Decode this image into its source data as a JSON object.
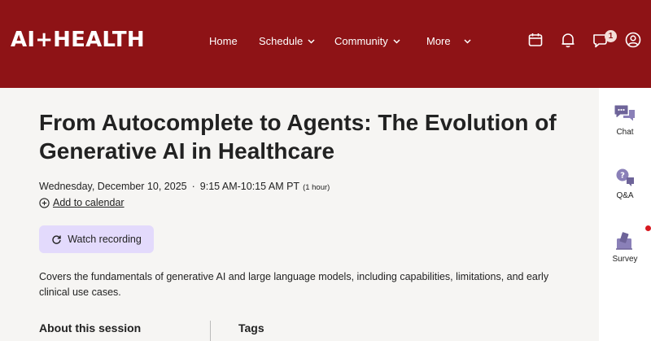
{
  "header": {
    "brand": "AI+HEALTH",
    "nav": [
      {
        "label": "Home",
        "dropdown": false
      },
      {
        "label": "Schedule",
        "dropdown": true
      },
      {
        "label": "Community",
        "dropdown": true
      },
      {
        "label": "More",
        "dropdown": true
      }
    ],
    "icons": [
      "calendar-icon",
      "bell-icon",
      "chat-icon",
      "profile-icon"
    ],
    "chat_badge": "1",
    "brand_color": "#8e1316"
  },
  "session": {
    "title": "From Autocomplete to Agents: The Evolution of Generative AI in Healthcare",
    "date": "Wednesday, December 10, 2025",
    "separator": "·",
    "time": "9:15 AM-10:15 AM PT",
    "duration": "(1 hour)",
    "add_to_calendar": "Add to calendar",
    "watch_label": "Watch recording",
    "description": "Covers the fundamentals of generative AI and large language models, including capabilities, limitations, and early clinical use cases.",
    "about_heading": "About this session",
    "tags_heading": "Tags"
  },
  "rail": {
    "items": [
      {
        "label": "Chat",
        "icon": "chat-bubbles-icon"
      },
      {
        "label": "Q&A",
        "icon": "question-bubble-icon"
      },
      {
        "label": "Survey",
        "icon": "survey-icon"
      }
    ],
    "accent": "#7a6fb0"
  },
  "colors": {
    "button_bg": "#e3dafc",
    "page_bg": "#f6f5f3",
    "notification_dot": "#d71920"
  }
}
